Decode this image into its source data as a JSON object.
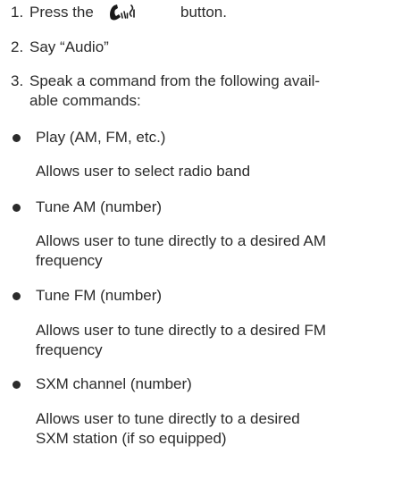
{
  "steps": [
    {
      "number": "1.",
      "text_before": "Press the",
      "icon": "talk-phone-icon",
      "text_after": "button."
    },
    {
      "number": "2.",
      "text": "Say “Audio”"
    },
    {
      "number": "3.",
      "lines": [
        "Speak a command from the following avail-",
        "able commands:"
      ]
    }
  ],
  "commands": [
    {
      "name": "Play (AM, FM, etc.)",
      "description": [
        "Allows user to select radio band"
      ]
    },
    {
      "name": "Tune AM (number)",
      "description": [
        "Allows user to tune directly to a desired AM",
        "frequency"
      ]
    },
    {
      "name": "Tune FM (number)",
      "description": [
        "Allows user to tune directly to a desired FM",
        "frequency"
      ]
    },
    {
      "name": "SXM channel (number)",
      "description": [
        "Allows user to tune directly to a desired",
        "SXM station (if so equipped)"
      ]
    }
  ]
}
